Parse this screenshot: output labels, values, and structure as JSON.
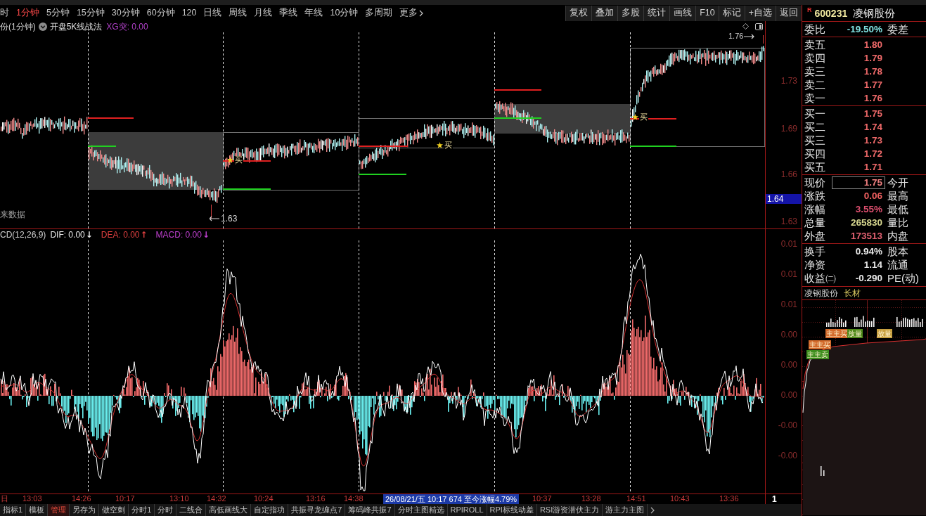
{
  "toolbar": {
    "periods": [
      {
        "label": "时",
        "selected": false
      },
      {
        "label": "1分钟",
        "selected": true
      },
      {
        "label": "5分钟",
        "selected": false
      },
      {
        "label": "15分钟",
        "selected": false
      },
      {
        "label": "30分钟",
        "selected": false
      },
      {
        "label": "60分钟",
        "selected": false
      },
      {
        "label": "120",
        "selected": false
      },
      {
        "label": "日线",
        "selected": false
      },
      {
        "label": "周线",
        "selected": false
      },
      {
        "label": "月线",
        "selected": false
      },
      {
        "label": "季线",
        "selected": false
      },
      {
        "label": "年线",
        "selected": false
      },
      {
        "label": "10分钟",
        "selected": false
      },
      {
        "label": "多周期",
        "selected": false
      },
      {
        "label": "更多",
        "selected": false
      }
    ],
    "buttons": [
      "复权",
      "叠加",
      "多股",
      "统计",
      "画线",
      "F10",
      "标记",
      "+自选",
      "返回"
    ]
  },
  "price_pane": {
    "title": "份(1分钟)",
    "indicator": "开盘5K线战法",
    "signal": "XG突: 0.00",
    "note": "来数据",
    "high_label": "1.76",
    "low_label": "1.63",
    "markers": [
      "买",
      "买",
      "买"
    ],
    "axis": [
      {
        "label": "1.73",
        "highlighted": false
      },
      {
        "label": "1.69",
        "highlighted": false
      },
      {
        "label": "1.66",
        "highlighted": false
      },
      {
        "label": "1.64",
        "highlighted": true
      },
      {
        "label": "1.63",
        "highlighted": false
      }
    ]
  },
  "macd_pane": {
    "title": "CD(12,26,9)",
    "lines": [
      {
        "label": "DIF: 0.00",
        "arrow": "↓",
        "color": "#e8e8e8"
      },
      {
        "label": "DEA: 0.00",
        "arrow": "↑",
        "color": "#e04040"
      },
      {
        "label": "MACD: 0.00",
        "arrow": "↓",
        "color": "#c040d0"
      }
    ],
    "axis": [
      "0.01",
      "0.01",
      "0.01",
      "0.00",
      "0.00",
      "0.00",
      "-0.00",
      "-0.00"
    ]
  },
  "time_axis": {
    "labels": [
      "日",
      "13:03",
      "14:26",
      "10:17",
      "13:10",
      "14:32",
      "10:24",
      "13:16",
      "14:38",
      "10:37",
      "13:28",
      "14:51",
      "10:43",
      "13:36"
    ],
    "tooltip": "26/08/21/五 10:17 674 至今涨幅4.79%",
    "edge_label": "1"
  },
  "bottom_tabs": [
    {
      "label": "指标1",
      "selected": false
    },
    {
      "label": "模板",
      "selected": false
    },
    {
      "label": "管理",
      "selected": true
    },
    {
      "label": "另存为",
      "selected": false
    },
    {
      "label": "做空刺",
      "selected": false
    },
    {
      "label": "分时1",
      "selected": false
    },
    {
      "label": "分时",
      "selected": false
    },
    {
      "label": "二线合",
      "selected": false
    },
    {
      "label": "高低画线大",
      "selected": false
    },
    {
      "label": "自定指功",
      "selected": false
    },
    {
      "label": "共振寻龙缠点7",
      "selected": false
    },
    {
      "label": "筹码峰共振7",
      "selected": false
    },
    {
      "label": "分时主图精选",
      "selected": false
    },
    {
      "label": "RPIROLL",
      "selected": false
    },
    {
      "label": "RPI标线动差",
      "selected": false
    },
    {
      "label": "RSI游资潜伏主力",
      "selected": false
    },
    {
      "label": "游主力主图",
      "selected": false
    }
  ],
  "quote_panel": {
    "badge": "R",
    "code": "600231",
    "name": "凌钢股份",
    "ratio": {
      "label": "委比",
      "value": "-19.50%",
      "label2": "委差"
    },
    "asks": [
      {
        "label": "卖五",
        "price": "1.80"
      },
      {
        "label": "卖四",
        "price": "1.79"
      },
      {
        "label": "卖三",
        "price": "1.78"
      },
      {
        "label": "卖二",
        "price": "1.77"
      },
      {
        "label": "卖一",
        "price": "1.76"
      }
    ],
    "bids": [
      {
        "label": "买一",
        "price": "1.75"
      },
      {
        "label": "买二",
        "price": "1.74"
      },
      {
        "label": "买三",
        "price": "1.73"
      },
      {
        "label": "买四",
        "price": "1.72"
      },
      {
        "label": "买五",
        "price": "1.71"
      }
    ],
    "stats": [
      {
        "label": "现价",
        "value": "1.75",
        "label2": "今开",
        "color": "#f08080",
        "highlighted": true
      },
      {
        "label": "涨跌",
        "value": "0.06",
        "label2": "最高",
        "color": "#f06060",
        "highlighted": false
      },
      {
        "label": "涨幅",
        "value": "3.55%",
        "label2": "最低",
        "color": "#e05070",
        "highlighted": false
      },
      {
        "label": "总量",
        "value": "265830",
        "label2": "量比",
        "color": "#d8d890",
        "highlighted": false
      },
      {
        "label": "外盘",
        "value": "173513",
        "label2": "内盘",
        "color": "#e06070",
        "highlighted": false
      }
    ],
    "fundamentals": [
      {
        "label": "换手",
        "value": "0.94%",
        "label2": "股本"
      },
      {
        "label": "净资",
        "value": "1.14",
        "label2": "流通"
      },
      {
        "label": "收益㈡",
        "value": "-0.290",
        "label2": "PE(动)"
      }
    ],
    "sector": {
      "name": "凌钢股份",
      "industry": "长材"
    },
    "tags": [
      {
        "label": "主主卖",
        "color": "#3e8e1e"
      },
      {
        "label": "主主买",
        "color": "#d2692a"
      },
      {
        "label": "主主买",
        "color": "#d2692a"
      },
      {
        "label": "放量",
        "color": "#4f8a1a"
      },
      {
        "label": "放量",
        "color": "#c8a040"
      }
    ]
  }
}
